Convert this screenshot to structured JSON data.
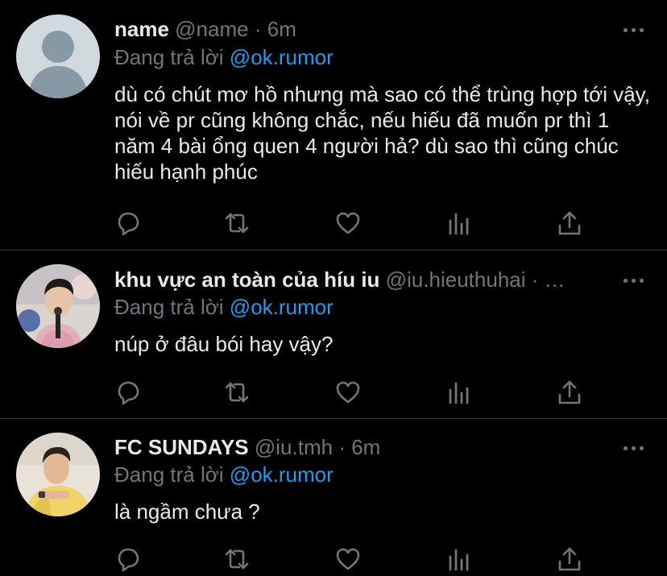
{
  "colors": {
    "background": "#000000",
    "text": "#e7e9ea",
    "secondary": "#71767b",
    "accent": "#1d9bf0",
    "divider": "#2f3336"
  },
  "tweets": [
    {
      "display_name": "name",
      "handle": "@name",
      "dot": "·",
      "time": "6m",
      "reply_prefix": "Đang trả lời",
      "reply_to": "@ok.rumor",
      "text": "dù có chút mơ hồ nhưng mà sao có thể trùng hợp tới vậy, nói về pr cũng không chắc, nếu hiếu đã muốn pr thì 1 năm 4 bài ổng quen 4 người hả? dù sao thì cũng chúc hiếu hạnh phúc",
      "avatar": "default-avatar"
    },
    {
      "display_name": "khu vực an toàn của híu iu",
      "handle": "@iu.hieuthuhai",
      "dot": "·",
      "time": "…",
      "reply_prefix": "Đang trả lời",
      "reply_to": "@ok.rumor",
      "text": "núp ở đâu bói hay vậy?",
      "avatar": "user-photo-avatar"
    },
    {
      "display_name": "FC SUNDAYS",
      "handle": "@iu.tmh",
      "dot": "·",
      "time": "6m",
      "reply_prefix": "Đang trả lời",
      "reply_to": "@ok.rumor",
      "text": "là ngầm chưa ?",
      "avatar": "user-photo-avatar"
    }
  ],
  "icons": {
    "reply": "reply-icon",
    "retweet": "retweet-icon",
    "like": "like-icon",
    "analytics": "analytics-icon",
    "share": "share-icon",
    "more": "more-icon"
  }
}
